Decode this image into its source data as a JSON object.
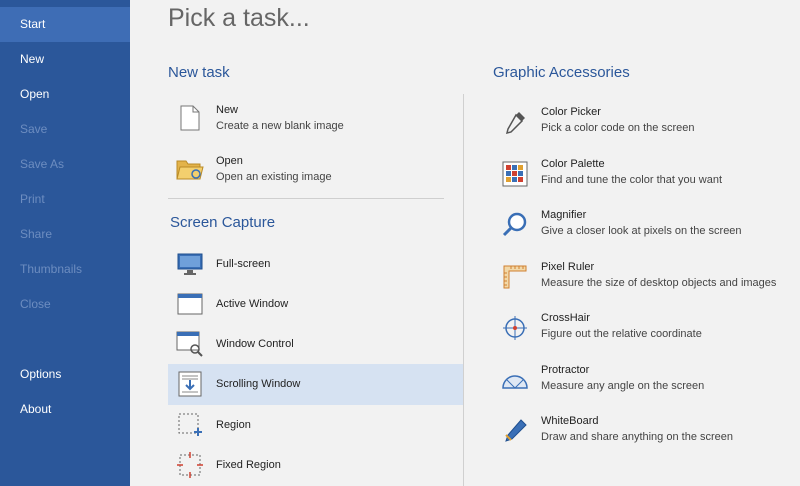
{
  "sidebar": {
    "items": [
      {
        "label": "Start"
      },
      {
        "label": "New"
      },
      {
        "label": "Open"
      },
      {
        "label": "Save"
      },
      {
        "label": "Save As"
      },
      {
        "label": "Print"
      },
      {
        "label": "Share"
      },
      {
        "label": "Thumbnails"
      },
      {
        "label": "Close"
      },
      {
        "label": "Options"
      },
      {
        "label": "About"
      }
    ]
  },
  "main": {
    "title": "Pick a task...",
    "new_task": {
      "heading": "New task",
      "items": [
        {
          "title": "New",
          "desc": "Create a new blank image",
          "icon": "new-file-icon"
        },
        {
          "title": "Open",
          "desc": "Open an existing image",
          "icon": "folder-open-icon"
        }
      ]
    },
    "screen_capture": {
      "heading": "Screen Capture",
      "items": [
        {
          "title": "Full-screen",
          "icon": "monitor-icon"
        },
        {
          "title": "Active Window",
          "icon": "window-icon"
        },
        {
          "title": "Window Control",
          "icon": "window-control-icon"
        },
        {
          "title": "Scrolling Window",
          "icon": "scrolling-window-icon"
        },
        {
          "title": "Region",
          "icon": "region-icon"
        },
        {
          "title": "Fixed Region",
          "icon": "fixed-region-icon"
        }
      ]
    },
    "graphic_accessories": {
      "heading": "Graphic Accessories",
      "items": [
        {
          "title": "Color Picker",
          "desc": "Pick a color code on the screen",
          "icon": "eyedropper-icon"
        },
        {
          "title": "Color Palette",
          "desc": "Find and tune the color that you want",
          "icon": "palette-icon"
        },
        {
          "title": "Magnifier",
          "desc": "Give a closer look at pixels on the screen",
          "icon": "magnifier-icon"
        },
        {
          "title": "Pixel Ruler",
          "desc": "Measure the size of desktop objects and images",
          "icon": "ruler-icon"
        },
        {
          "title": "CrossHair",
          "desc": "Figure out the relative coordinate",
          "icon": "crosshair-icon"
        },
        {
          "title": "Protractor",
          "desc": "Measure any angle on the screen",
          "icon": "protractor-icon"
        },
        {
          "title": "WhiteBoard",
          "desc": "Draw and share anything on the screen",
          "icon": "pen-icon"
        }
      ]
    }
  },
  "colors": {
    "sidebar_bg": "#2b579a",
    "sidebar_active": "#3e6db5",
    "accent": "#2b579a",
    "selected_bg": "#d6e2f2"
  }
}
